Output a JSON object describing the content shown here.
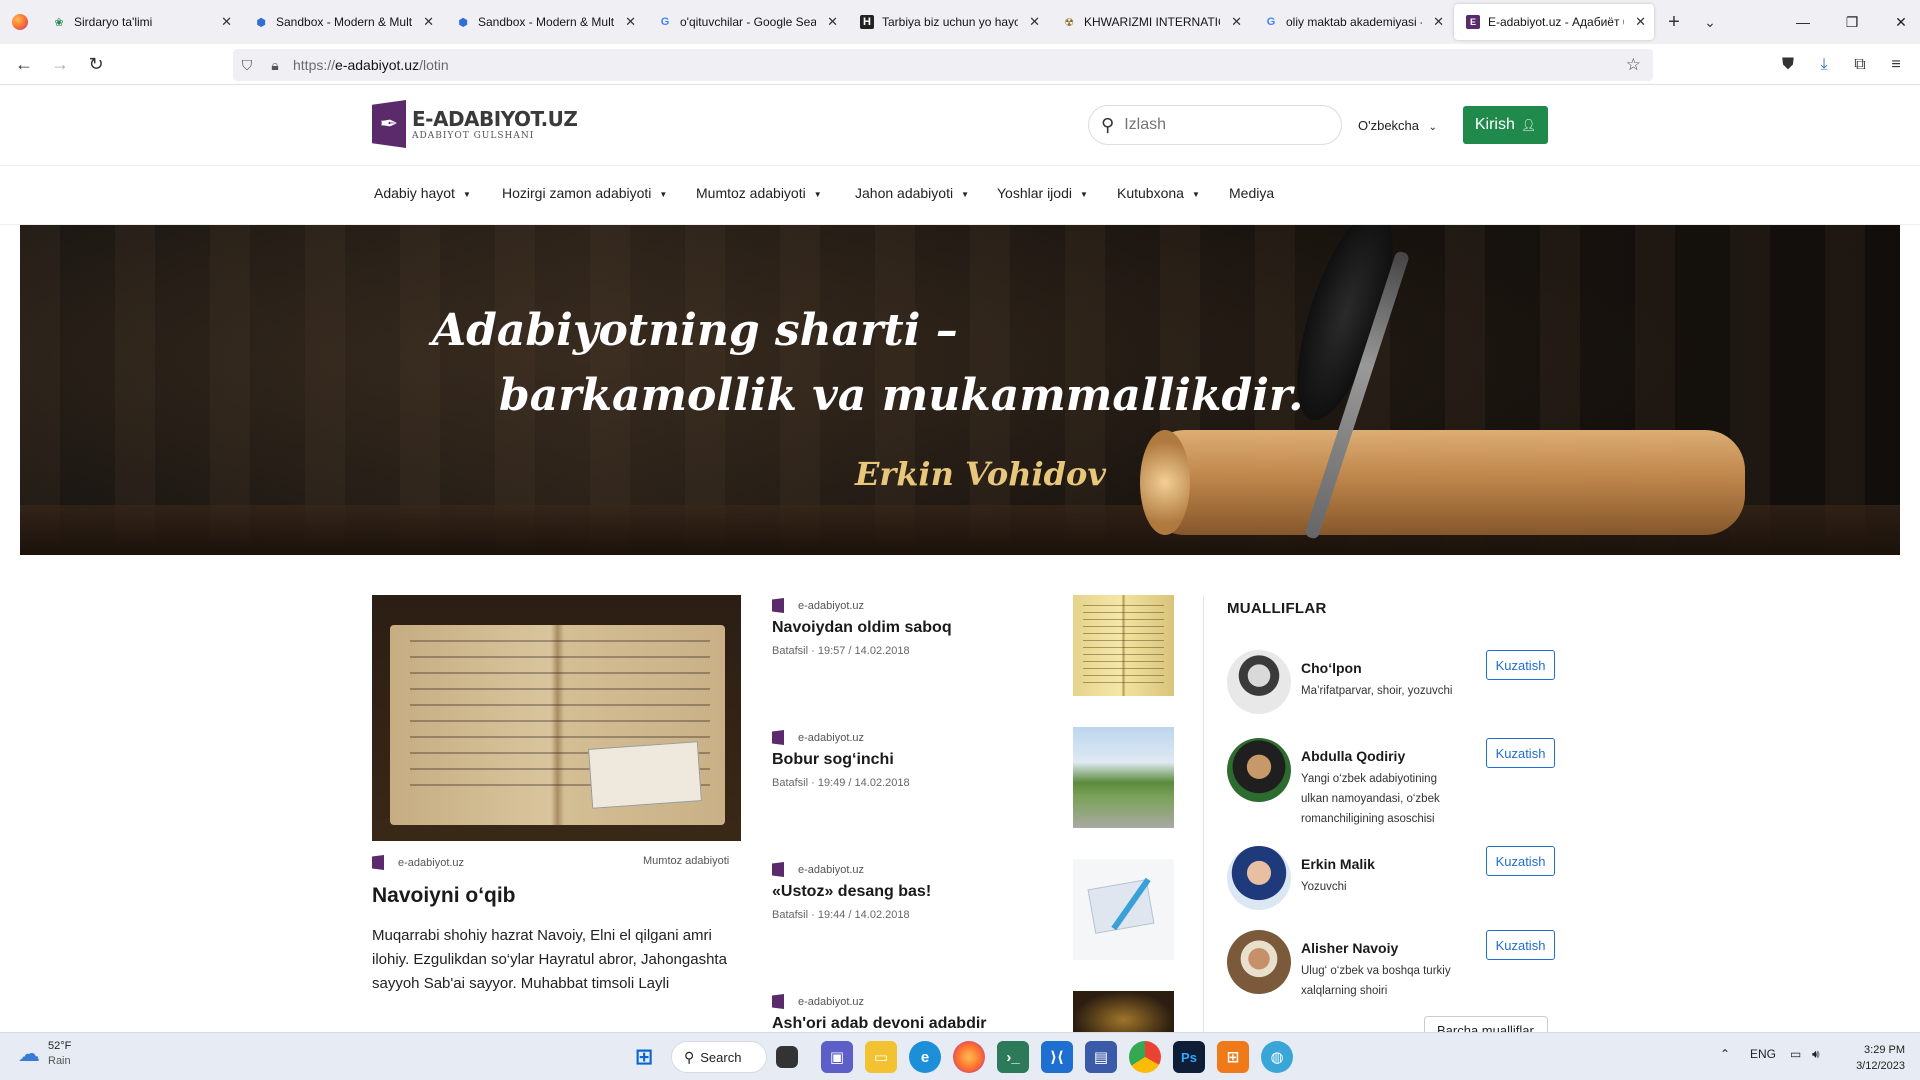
{
  "browser": {
    "tabs": [
      {
        "label": "Sirdaryo ta'limi",
        "favicon": "leaf-icon",
        "active": false
      },
      {
        "label": "Sandbox - Modern & Multi",
        "favicon": "hexagon-icon",
        "active": false
      },
      {
        "label": "Sandbox - Modern & Multi",
        "favicon": "hexagon-icon",
        "active": false
      },
      {
        "label": "o'qituvchilar - Google Search",
        "favicon": "google-icon",
        "active": false
      },
      {
        "label": "Tarbiya biz uchun yo hayot",
        "favicon": "h-square-icon",
        "active": false
      },
      {
        "label": "KHWARIZMI INTERNATIONAL",
        "favicon": "atom-icon",
        "active": false
      },
      {
        "label": "oliy maktab akademiyasi - G",
        "favicon": "google-icon",
        "active": false
      },
      {
        "label": "E-adabiyot.uz - Адабиёт бў",
        "favicon": "adabiyot-icon",
        "active": true
      }
    ],
    "url_prefix": "https://",
    "url_host": "e-adabiyot.uz",
    "url_path": "/lotin"
  },
  "site": {
    "logo_title": "E-ADABIYOT.UZ",
    "logo_subtitle": "ADABIYOT GULSHANI",
    "search_placeholder": "Izlash",
    "language": "O'zbekcha",
    "login_label": "Kirish",
    "menu": [
      {
        "label": "Adabiy hayot",
        "dropdown": true
      },
      {
        "label": "Hozirgi zamon adabiyoti",
        "dropdown": true
      },
      {
        "label": "Mumtoz adabiyoti",
        "dropdown": true
      },
      {
        "label": "Jahon adabiyoti",
        "dropdown": true
      },
      {
        "label": "Yoshlar ijodi",
        "dropdown": true
      },
      {
        "label": "Kutubxona",
        "dropdown": true
      },
      {
        "label": "Mediya",
        "dropdown": false
      }
    ]
  },
  "hero": {
    "quote_line1": "Adabiyotning sharti –",
    "quote_line2": "barkamollik va mukammallikdir.",
    "author": "Erkin Vohidov"
  },
  "featured": {
    "source": "e-adabiyot.uz",
    "category": "Mumtoz adabiyoti",
    "title": "Navoiyni o‘qib",
    "excerpt": "Muqarrabi shohiy hazrat Navoiy, Elni el qilgani amri ilohiy. Ezgulikdan so‘ylar Hayratul abror, Jahongashta sayyoh Sab'ai sayyor. Muhabbat timsoli Layli"
  },
  "articles": [
    {
      "source": "e-adabiyot.uz",
      "title": "Navoiydan oldim saboq",
      "meta": "Batafsil · 19:57 / 14.02.2018"
    },
    {
      "source": "e-adabiyot.uz",
      "title": "Bobur sog‘inchi",
      "meta": "Batafsil · 19:49 / 14.02.2018"
    },
    {
      "source": "e-adabiyot.uz",
      "title": "«Ustoz» desang bas!",
      "meta": "Batafsil · 19:44 / 14.02.2018"
    },
    {
      "source": "e-adabiyot.uz",
      "title": "Ash'ori adab devoni adabdir",
      "meta": ""
    }
  ],
  "sidebar": {
    "heading": "MUALLIFLAR",
    "follow_label": "Kuzatish",
    "authors": [
      {
        "name": "Cho‘lpon",
        "desc": "Ma’rifatparvar, shoir, yozuvchi"
      },
      {
        "name": "Abdulla Qodiriy",
        "desc": "Yangi o‘zbek adabiyotining ulkan namoyandasi, o‘zbek romanchiligining asoschisi"
      },
      {
        "name": "Erkin Malik",
        "desc": "Yozuvchi"
      },
      {
        "name": "Alisher Navoiy",
        "desc": "Ulug‘ o‘zbek va boshqa turkiy xalqlarning shoiri"
      }
    ],
    "more_label": "Barcha mualliflar"
  },
  "taskbar": {
    "temperature": "52°F",
    "condition": "Rain",
    "search_label": "Search",
    "lang": "ENG",
    "time": "3:29 PM",
    "date": "3/12/2023"
  },
  "colors": {
    "brand_purple": "#5a2a6b",
    "login_green": "#1f8a4c",
    "follow_blue": "#1f6fd1",
    "hero_author_gold": "#e8c77a"
  }
}
